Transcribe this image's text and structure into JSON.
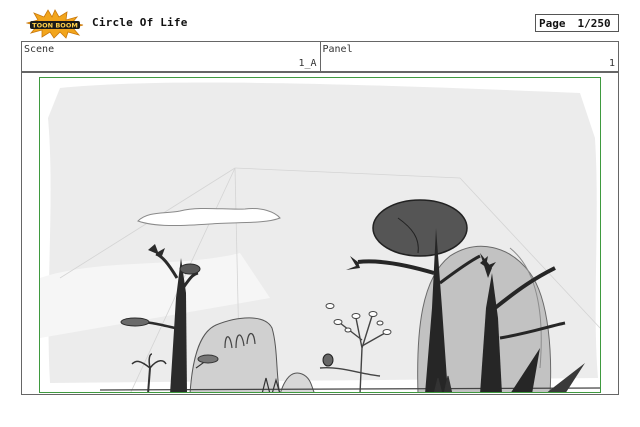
{
  "header": {
    "logo_text": "TOON BOOM",
    "title": "Circle Of Life",
    "page_label": "Page",
    "page_value": "1/250"
  },
  "info": {
    "scene_label": "Scene",
    "scene_value": "1_A",
    "panel_label": "Panel",
    "panel_value": "1"
  },
  "colors": {
    "frame_border": "#3f9a3f",
    "logo_burst": "#f2a51c",
    "sketch_dark": "#2b2b2b"
  }
}
